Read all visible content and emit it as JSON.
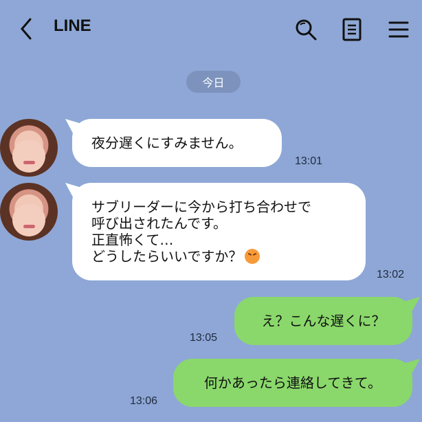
{
  "header": {
    "title": "LINE",
    "back_icon": "chevron-left-icon",
    "search_icon": "search-icon",
    "note_icon": "note-icon",
    "menu_icon": "menu-icon"
  },
  "date_label": "今日",
  "messages": [
    {
      "side": "incoming",
      "text": "夜分遅くにすみません。",
      "time": "13:01"
    },
    {
      "side": "incoming",
      "text": "サブリーダーに今から打ち合わせで\n呼び出されたんです。\n正直怖くて…\nどうしたらいいですか？",
      "time": "13:02",
      "emoji": "persevering-face"
    },
    {
      "side": "outgoing",
      "text": "え？こんな遅くに？",
      "time": "13:05"
    },
    {
      "side": "outgoing",
      "text": "何かあったら連絡してきて。",
      "time": "13:06"
    }
  ],
  "colors": {
    "background": "#8ea7d6",
    "incoming_bubble": "#ffffff",
    "outgoing_bubble": "#8ad86b",
    "date_pill": "#7d93bd"
  }
}
